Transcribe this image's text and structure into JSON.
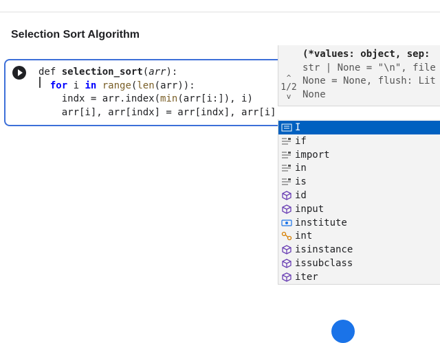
{
  "cell": {
    "title": "Selection Sort Algorithm",
    "code_lines": [
      {
        "parts": [
          [
            "kw-def",
            "def"
          ],
          [
            "sp",
            " "
          ],
          [
            "fn",
            "selection_sort"
          ],
          [
            "p",
            "("
          ],
          [
            "it",
            "arr"
          ],
          [
            "p",
            "):"
          ]
        ]
      },
      {
        "parts": [
          [
            "sp",
            "  "
          ],
          [
            "kw",
            "for"
          ],
          [
            "p",
            " i "
          ],
          [
            "kw",
            "in"
          ],
          [
            "p",
            " "
          ],
          [
            "bi",
            "range"
          ],
          [
            "p",
            "("
          ],
          [
            "bi",
            "len"
          ],
          [
            "p",
            "(arr)):"
          ]
        ]
      },
      {
        "parts": [
          [
            "sp",
            "    "
          ],
          [
            "p",
            "indx = arr.index("
          ],
          [
            "bi",
            "min"
          ],
          [
            "p",
            "(arr[i:]), i)"
          ]
        ]
      },
      {
        "parts": [
          [
            "sp",
            "    "
          ],
          [
            "p",
            "arr[i], arr[indx] = arr[indx], arr[i]"
          ]
        ]
      }
    ]
  },
  "signature": {
    "counter": "1/2",
    "lines": [
      "(*values: object, sep:",
      "str | None = \"\\n\", file",
      "None = None, flush: Lit",
      "None"
    ]
  },
  "suggestions": [
    {
      "label": "I",
      "icon": "keyword-icon",
      "selected": true
    },
    {
      "label": "if",
      "icon": "snippet-icon",
      "selected": false
    },
    {
      "label": "import",
      "icon": "snippet-icon",
      "selected": false
    },
    {
      "label": "in",
      "icon": "snippet-icon",
      "selected": false
    },
    {
      "label": "is",
      "icon": "snippet-icon",
      "selected": false
    },
    {
      "label": "id",
      "icon": "cube-icon",
      "selected": false
    },
    {
      "label": "input",
      "icon": "cube-icon",
      "selected": false
    },
    {
      "label": "institute",
      "icon": "variable-icon",
      "selected": false
    },
    {
      "label": "int",
      "icon": "class-icon",
      "selected": false
    },
    {
      "label": "isinstance",
      "icon": "cube-icon",
      "selected": false
    },
    {
      "label": "issubclass",
      "icon": "cube-icon",
      "selected": false
    },
    {
      "label": "iter",
      "icon": "cube-icon",
      "selected": false
    }
  ],
  "colors": {
    "accent": "#3c6fd8",
    "selected": "#0060c0",
    "keyword": "#0000ff",
    "builtin": "#795e26"
  }
}
